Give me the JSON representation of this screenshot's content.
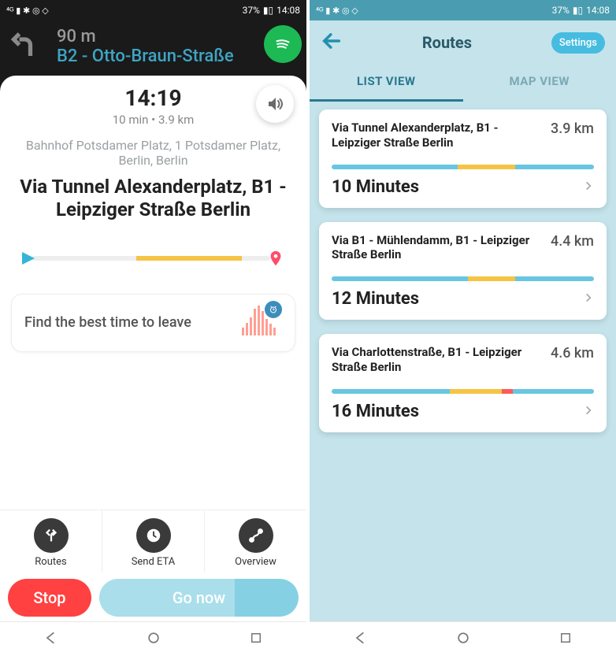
{
  "status": {
    "left_icons": "⁴⁶ ⬚ ✱ ◉ ⟐",
    "battery": "37%",
    "time": "14:08"
  },
  "left": {
    "turn": {
      "distance": "90 m",
      "street": "B2 - Otto-Braun-Straße"
    },
    "eta": {
      "time": "14:19",
      "duration": "10 min",
      "distance": "3.9 km"
    },
    "destination": "Bahnhof Potsdamer Platz, 1 Potsdamer Platz, Berlin, Berlin",
    "via": "Via Tunnel Alexander­platz, B1 - Leipziger Straße Berlin",
    "best_time": "Find the best time to leave",
    "actions": {
      "routes": "Routes",
      "send_eta": "Send ETA",
      "overview": "Overview"
    },
    "buttons": {
      "stop": "Stop",
      "go": "Go now"
    }
  },
  "right": {
    "title": "Routes",
    "settings": "Settings",
    "tabs": {
      "list": "LIST VIEW",
      "map": "MAP VIEW"
    },
    "routes": [
      {
        "via": "Via Tunnel Alexanderplatz, B1 - Leipziger Straße Berlin",
        "distance": "3.9 km",
        "time": "10 Minutes",
        "segments": [
          {
            "color": "#68c6e2",
            "pct": 48
          },
          {
            "color": "#f6c445",
            "pct": 22
          },
          {
            "color": "#68c6e2",
            "pct": 30
          }
        ]
      },
      {
        "via": "Via B1 - Mühlendamm, B1 - Leipziger Straße Berlin",
        "distance": "4.4 km",
        "time": "12 Minutes",
        "segments": [
          {
            "color": "#68c6e2",
            "pct": 52
          },
          {
            "color": "#f6c445",
            "pct": 18
          },
          {
            "color": "#68c6e2",
            "pct": 30
          }
        ]
      },
      {
        "via": "Via Charlottenstraße, B1 - Leipziger Straße Berlin",
        "distance": "4.6 km",
        "time": "16 Minutes",
        "segments": [
          {
            "color": "#68c6e2",
            "pct": 45
          },
          {
            "color": "#f6c445",
            "pct": 20
          },
          {
            "color": "#ff5a5a",
            "pct": 4
          },
          {
            "color": "#68c6e2",
            "pct": 31
          }
        ]
      }
    ]
  }
}
